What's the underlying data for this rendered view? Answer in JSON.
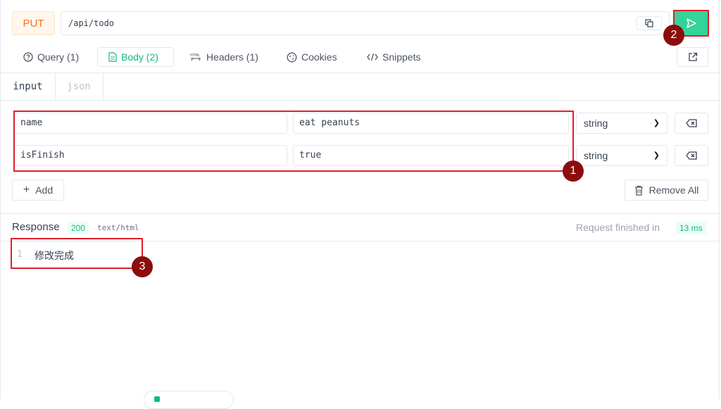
{
  "request": {
    "method": "PUT",
    "url": "/api/todo"
  },
  "tabs": [
    {
      "label": "Query (1)"
    },
    {
      "label": "Body (2)"
    },
    {
      "label": "Headers (1)"
    },
    {
      "label": "Cookies"
    },
    {
      "label": "Snippets"
    }
  ],
  "body_tabs": [
    "input",
    "json"
  ],
  "params": [
    {
      "key": "name",
      "value": "eat peanuts",
      "type": "string"
    },
    {
      "key": "isFinish",
      "value": "true",
      "type": "string"
    }
  ],
  "actions": {
    "add_label": "Add",
    "remove_all_label": "Remove All"
  },
  "response": {
    "label": "Response",
    "status": "200",
    "content_type": "text/html",
    "finished_label": "Request finished in",
    "duration": "13 ms",
    "lines": [
      {
        "number": "1",
        "text": "修改完成"
      }
    ]
  },
  "annotations": [
    "1",
    "2",
    "3"
  ],
  "colors": {
    "accent": "#10b981",
    "send_button": "#34d399",
    "method": "#f97316",
    "annotation_box": "#e11d2e",
    "annotation_marker": "#8b0d0d"
  }
}
